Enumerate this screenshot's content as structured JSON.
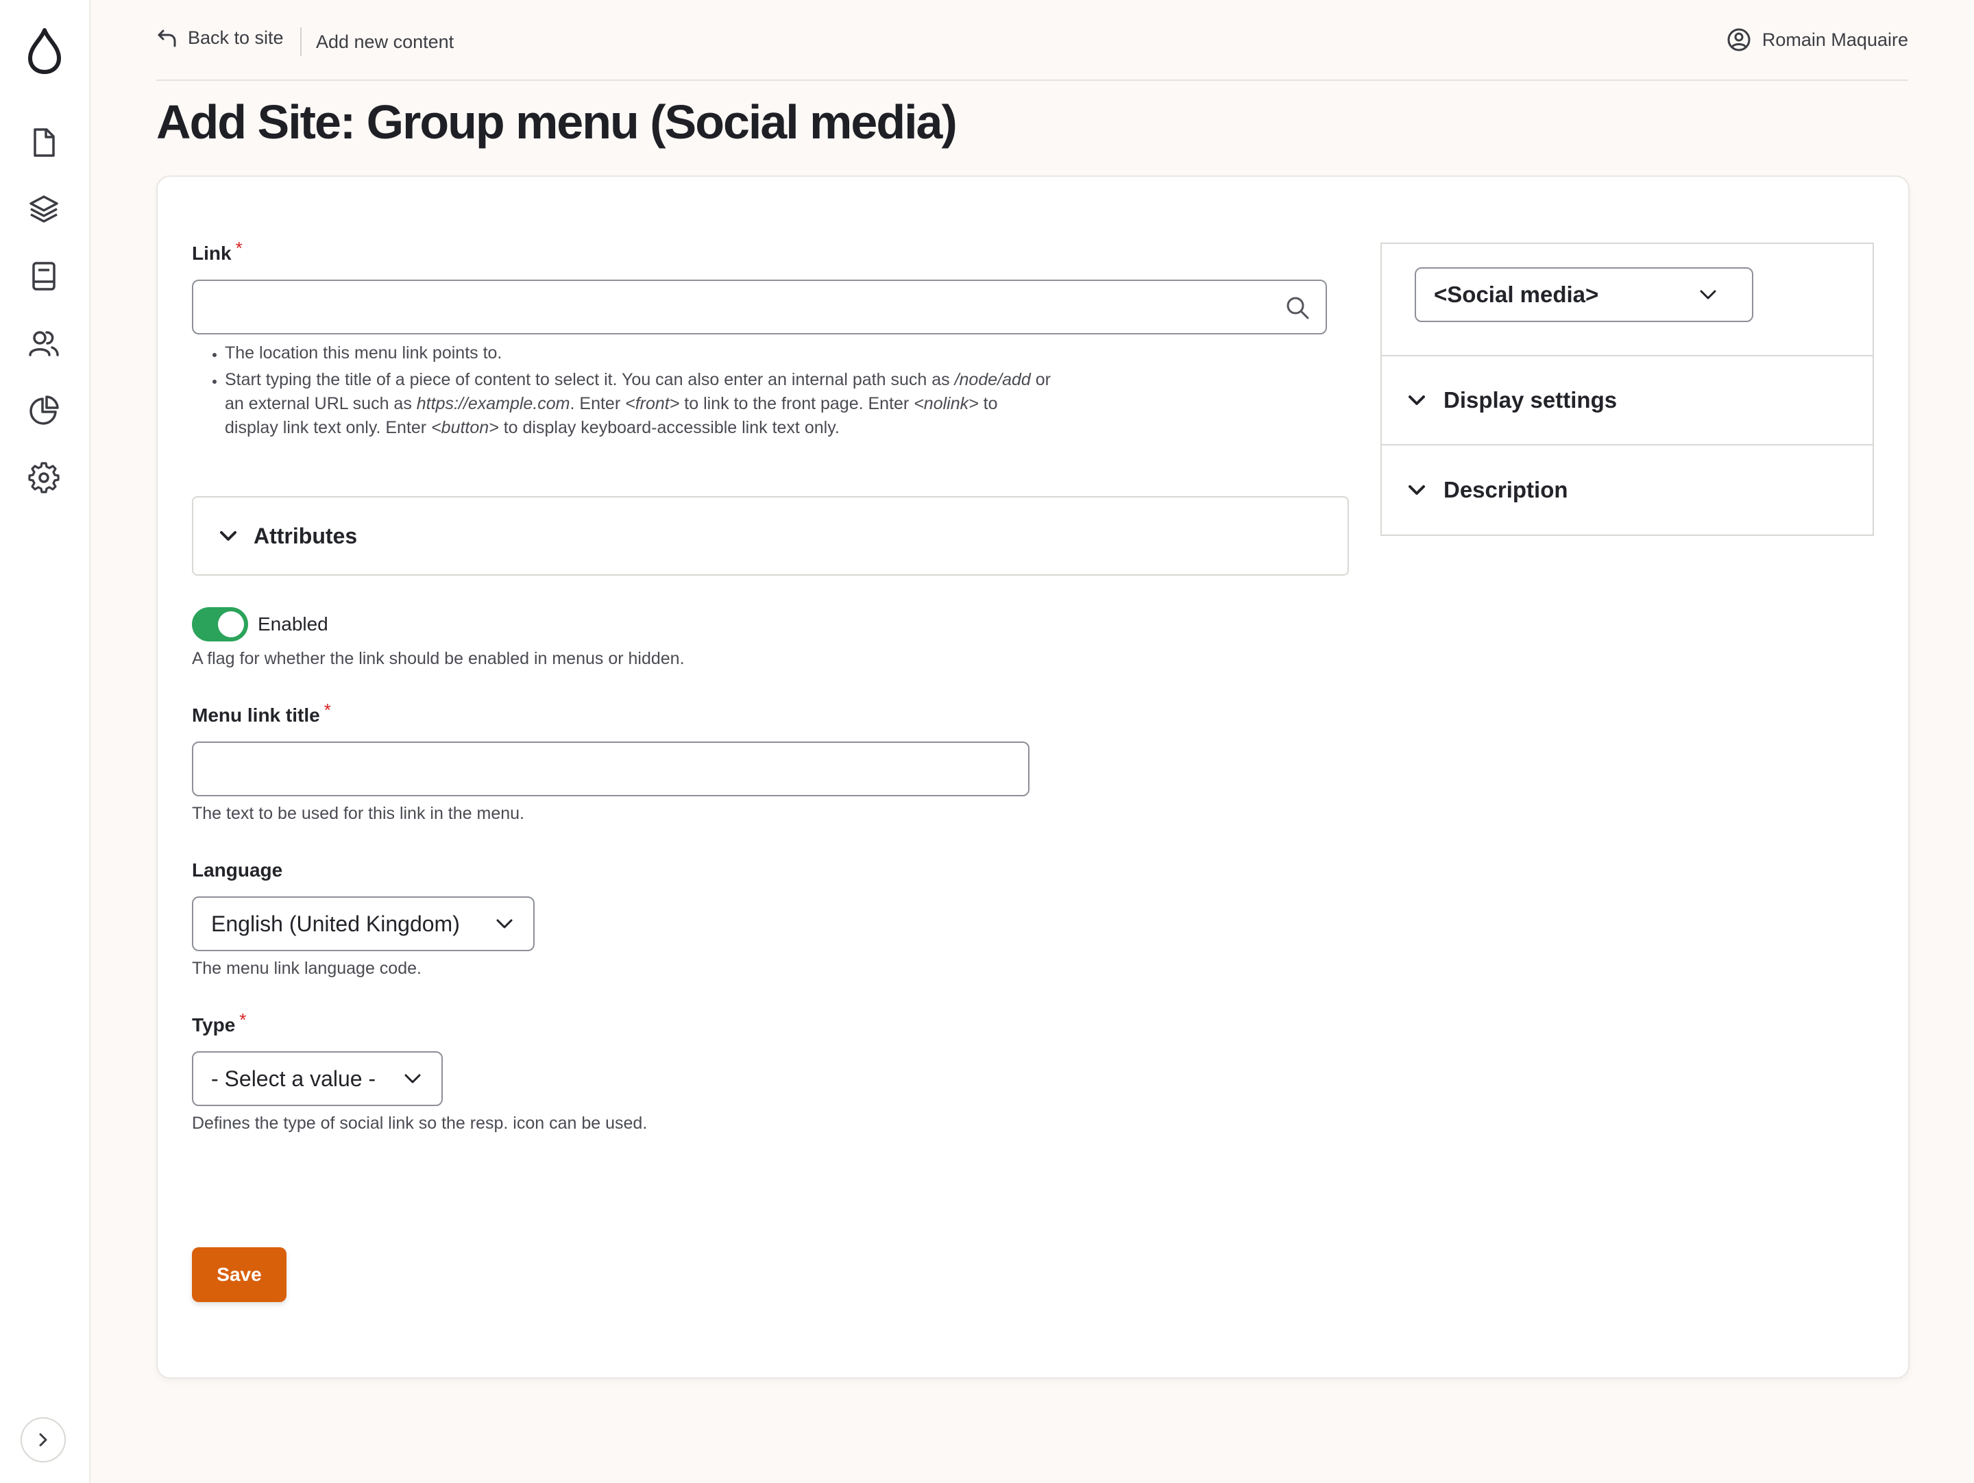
{
  "topbar": {
    "back_label": "Back to site",
    "add_new_label": "Add new content",
    "user_name": "Romain Maquaire"
  },
  "page": {
    "title": "Add Site: Group menu (Social media)"
  },
  "form": {
    "link": {
      "label": "Link",
      "required_mark": "*",
      "value": "",
      "help": [
        "The location this menu link points to.",
        "Start typing the title of a piece of content to select it. You can also enter an internal path such as /node/add or an external URL such as https://example.com. Enter <front> to link to the front page. Enter <nolink> to display link text only. Enter <button> to display keyboard-accessible link text only."
      ],
      "help_parts": {
        "p1": "Start typing the title of a piece of content to select it. You can also enter an internal path such as ",
        "em1": "/node/add",
        "p2": " or an external URL such as ",
        "em2": "https://example.com",
        "p3": ". Enter ",
        "em3": "<front>",
        "p4": " to link to the front page. Enter ",
        "em4": "<nolink>",
        "p5": " to display link text only. Enter ",
        "em5": "<button>",
        "p6": " to display keyboard-accessible link text only."
      }
    },
    "attributes": {
      "label": "Attributes"
    },
    "enabled": {
      "label": "Enabled",
      "checked": true,
      "help": "A flag for whether the link should be enabled in menus or hidden."
    },
    "menu_link_title": {
      "label": "Menu link title",
      "required_mark": "*",
      "value": "",
      "help": "The text to be used for this link in the menu."
    },
    "language": {
      "label": "Language",
      "selected": "English (United Kingdom)",
      "help": "The menu link language code."
    },
    "type": {
      "label": "Type",
      "required_mark": "*",
      "selected": "- Select a value -",
      "help": "Defines the type of social link so the resp. icon can be used."
    },
    "save_label": "Save"
  },
  "sidebar_panel": {
    "menu_select": "<Social media>",
    "display_settings": "Display settings",
    "description": "Description"
  },
  "colors": {
    "accent": "#d9600b",
    "toggle_on": "#2ba35a",
    "required": "#d72222",
    "background": "#fcf9f6"
  }
}
